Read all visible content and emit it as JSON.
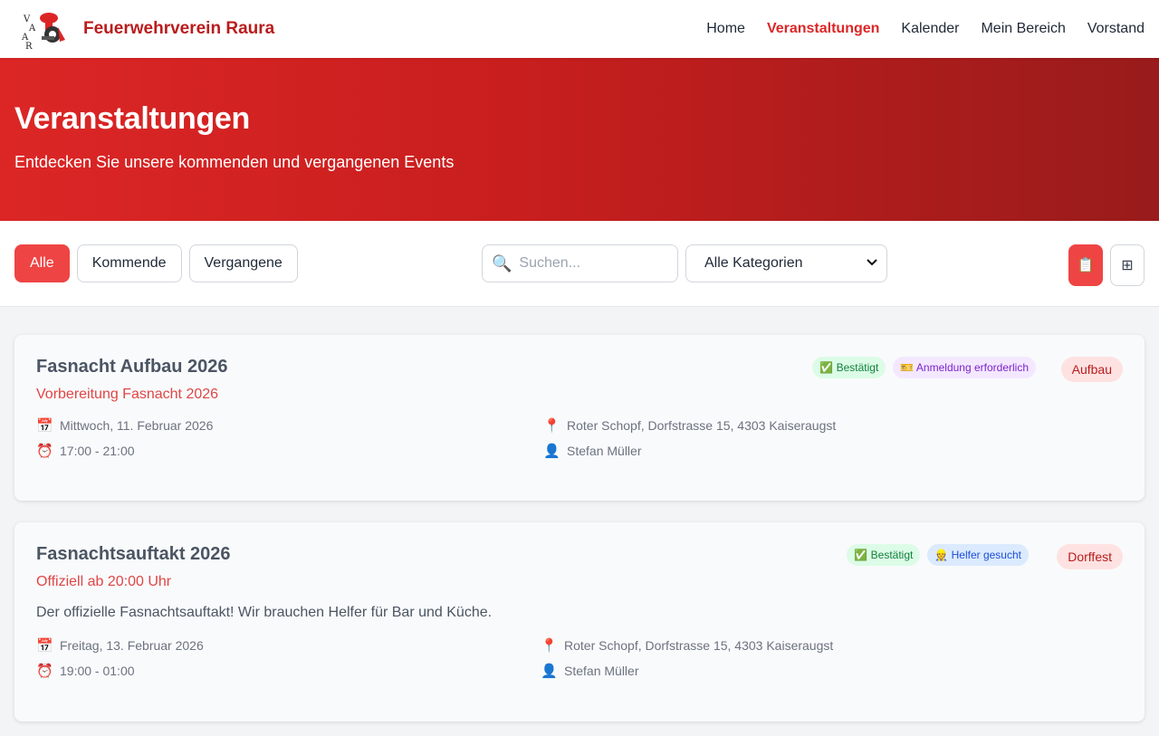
{
  "header": {
    "brand_name": "Feuerwehrverein Raura",
    "nav": [
      {
        "label": "Home",
        "active": false
      },
      {
        "label": "Veranstaltungen",
        "active": true
      },
      {
        "label": "Kalender",
        "active": false
      },
      {
        "label": "Mein Bereich",
        "active": false
      },
      {
        "label": "Vorstand",
        "active": false
      }
    ]
  },
  "hero": {
    "title": "Veranstaltungen",
    "subtitle": "Entdecken Sie unsere kommenden und vergangenen Events"
  },
  "filters": {
    "tabs": [
      "Alle",
      "Kommende",
      "Vergangene"
    ],
    "active_tab": "Alle",
    "search_placeholder": "Suchen...",
    "search_icon": "magnifier-icon",
    "category_selected": "Alle Kategorien",
    "view_list_icon": "📋",
    "view_grid_icon": "⊞"
  },
  "events": [
    {
      "title": "Fasnacht Aufbau 2026",
      "subtitle": "Vorbereitung Fasnacht 2026",
      "description": "",
      "date": "Mittwoch, 11. Februar 2026",
      "time": "17:00 - 21:00",
      "location": "Roter Schopf, Dorfstrasse 15, 4303 Kaiseraugst",
      "contact": "Stefan Müller",
      "badges": [
        {
          "text": "✅ Bestätigt",
          "color": "green"
        },
        {
          "text": "🎫 Anmeldung erforderlich",
          "color": "purple"
        }
      ],
      "category": "Aufbau"
    },
    {
      "title": "Fasnachtsauftakt 2026",
      "subtitle": "Offiziell ab 20:00 Uhr",
      "description": "Der offizielle Fasnachtsauftakt! Wir brauchen Helfer für Bar und Küche.",
      "date": "Freitag, 13. Februar 2026",
      "time": "19:00 - 01:00",
      "location": "Roter Schopf, Dorfstrasse 15, 4303 Kaiseraugst",
      "contact": "Stefan Müller",
      "badges": [
        {
          "text": "✅ Bestätigt",
          "color": "green"
        },
        {
          "text": "👷 Helfer gesucht",
          "color": "blue"
        }
      ],
      "category": "Dorffest"
    }
  ],
  "icons": {
    "calendar": "📅",
    "clock": "⏰",
    "pin": "📍",
    "person": "👤"
  },
  "colors": {
    "accent": "#dc2626",
    "hero_start": "#dc2626",
    "hero_end": "#991b1b"
  }
}
